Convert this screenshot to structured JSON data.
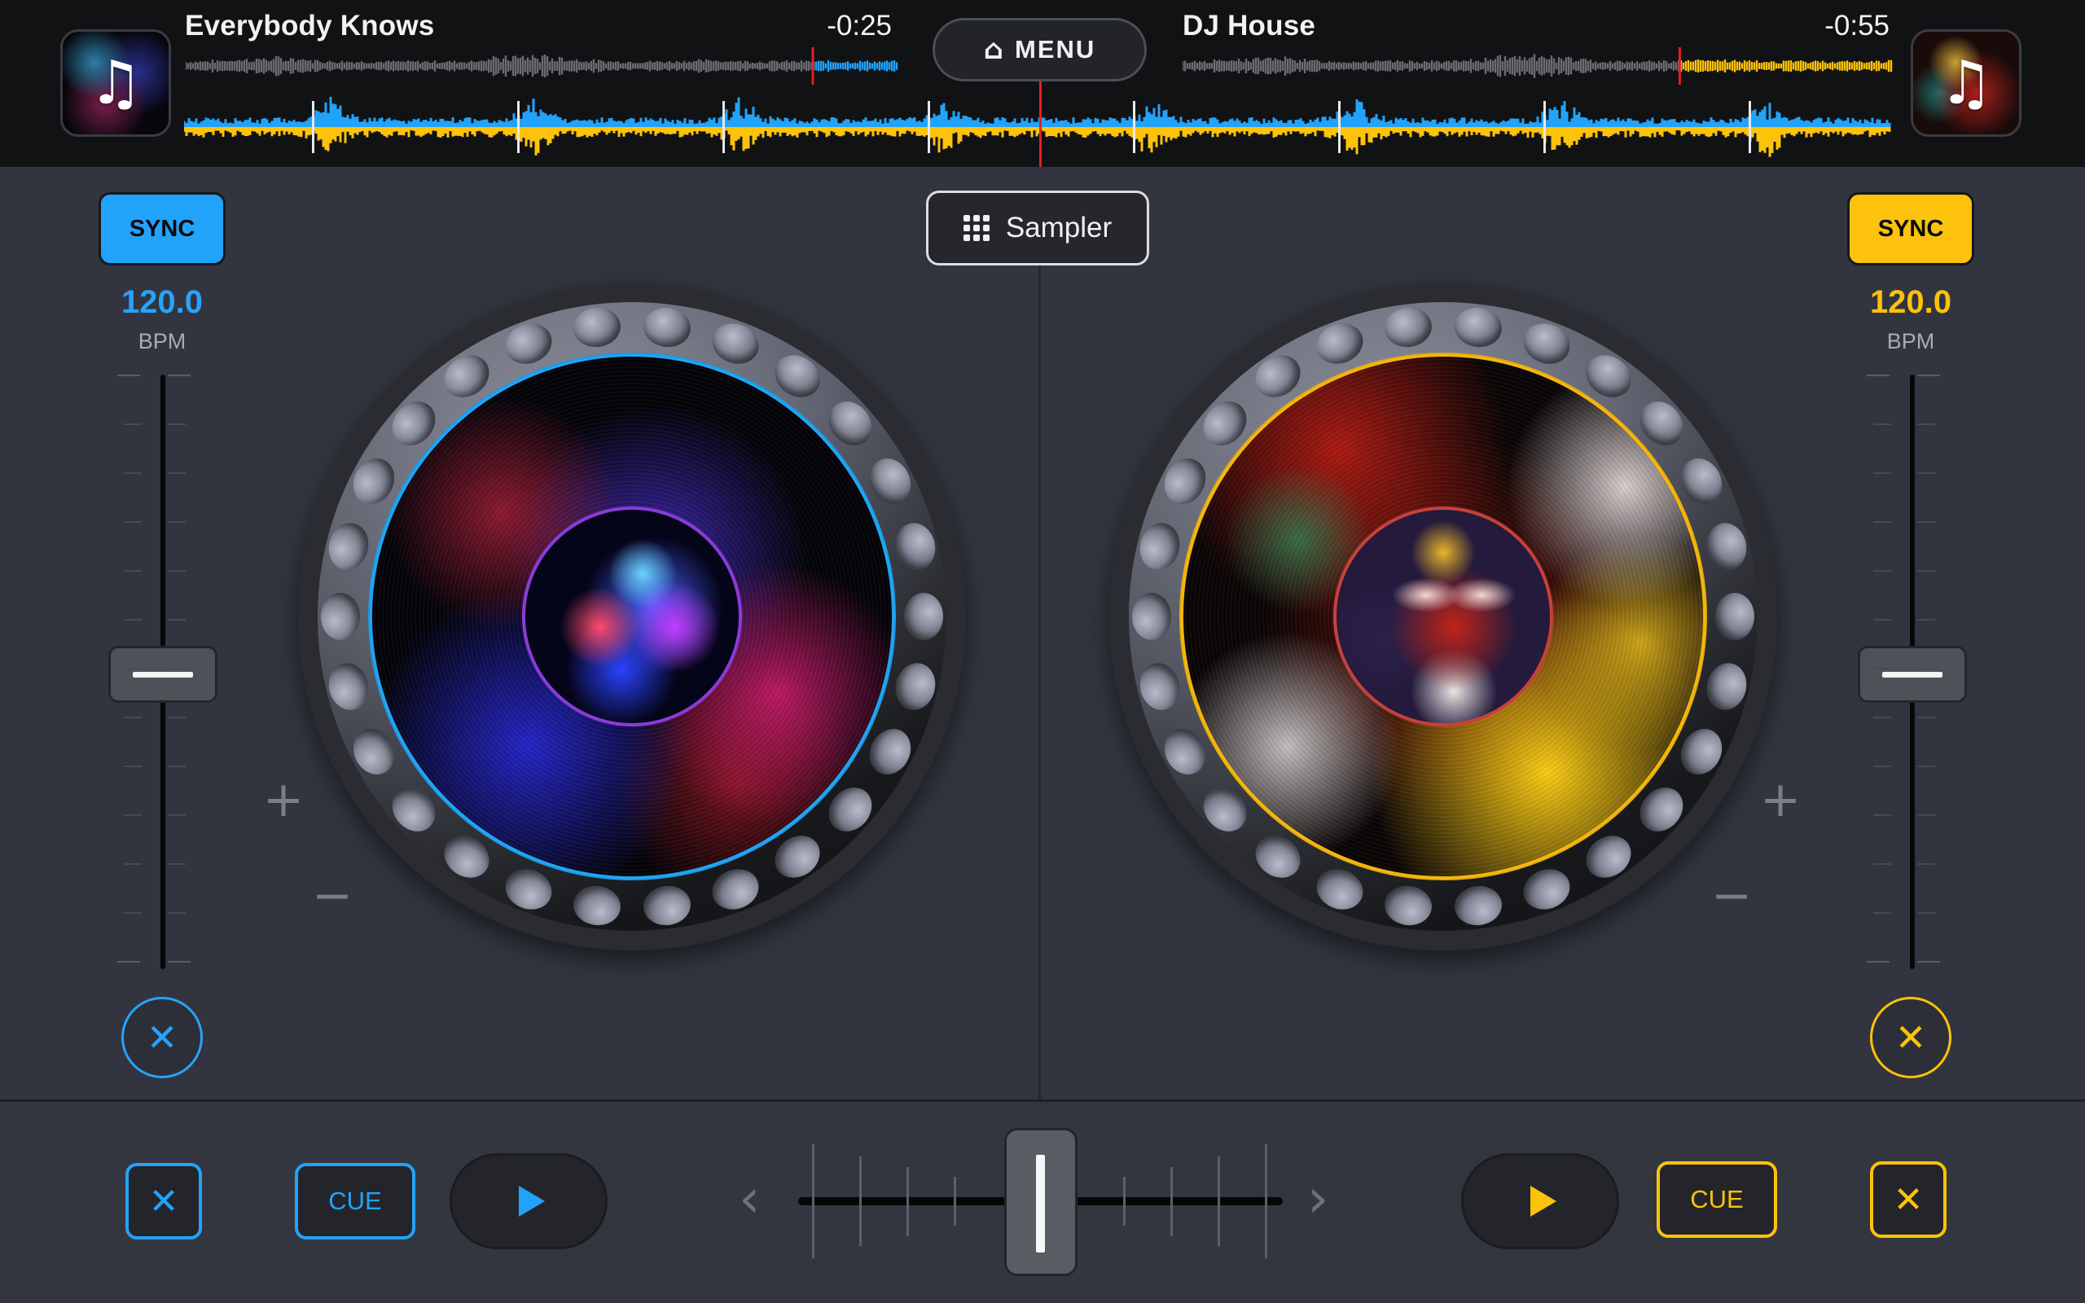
{
  "menu": {
    "label": "MENU",
    "icon": "home-icon"
  },
  "sampler": {
    "label": "Sampler",
    "icon": "grid-icon"
  },
  "colors": {
    "deck_a_accent": "#22a3fb",
    "deck_b_accent": "#fcc20c",
    "position_marker": "#e02020"
  },
  "deck_a": {
    "track_title": "Everybody Knows",
    "time_remaining": "-0:25",
    "artwork_icon": "music-note-icon",
    "overview_progress_percent": 88,
    "sync_label": "SYNC",
    "bpm": "120.0",
    "bpm_label": "BPM",
    "pitch_slider_percent": 50,
    "pitch_plus": "+",
    "pitch_minus": "−",
    "clear_icon": "✕",
    "cue_label": "CUE",
    "play_icon": "play-icon",
    "x_label": "✕"
  },
  "deck_b": {
    "track_title": "DJ House",
    "time_remaining": "-0:55",
    "artwork_icon": "music-note-icon",
    "overview_progress_percent": 70,
    "sync_label": "SYNC",
    "bpm": "120.0",
    "bpm_label": "BPM",
    "pitch_slider_percent": 50,
    "pitch_plus": "+",
    "pitch_minus": "−",
    "clear_icon": "✕",
    "cue_label": "CUE",
    "play_icon": "play-icon",
    "x_label": "✕"
  },
  "crossfader": {
    "position_percent": 50,
    "left_arrow": "‹",
    "right_arrow": "›"
  },
  "glyphs": {
    "music_note": "♫",
    "home": "⌂"
  }
}
